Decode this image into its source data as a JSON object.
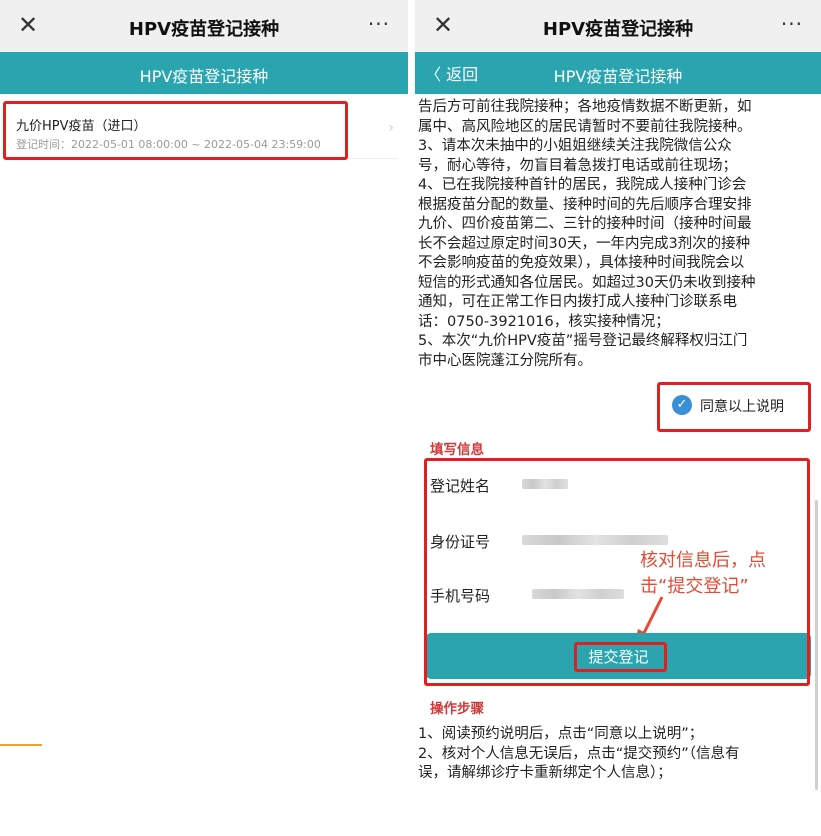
{
  "left_panel": {
    "topbar": {
      "close_icon": "close-icon",
      "title": "HPV疫苗登记接种",
      "more_icon": "more-icon"
    },
    "header": {
      "title": "HPV疫苗登记接种"
    },
    "vaccine_item": {
      "name": "九价HPV疫苗（进口）",
      "time": "登记时间：2022-05-01 08:00:00 ~ 2022-05-04 23:59:00",
      "chevron": "›"
    }
  },
  "right_panel": {
    "topbar": {
      "close_icon": "close-icon",
      "title": "HPV疫苗登记接种",
      "more_icon": "more-icon"
    },
    "header": {
      "back": "〈 返回",
      "title": "HPV疫苗登记接种"
    },
    "notice_lines": [
      "告后方可前往我院接种；各地疫情数据不断更新，如",
      "属中、高风险地区的居民请暂时不要前往我院接种。",
      "3、请本次未抽中的小姐姐继续关注我院微信公众",
      "号，耐心等待，勿盲目着急拨打电话或前往现场；",
      "4、已在我院接种首针的居民，我院成人接种门诊会",
      "根据疫苗分配的数量、接种时间的先后顺序合理安排",
      "九价、四价疫苗第二、三针的接种时间（接种时间最",
      "长不会超过原定时间30天，一年内完成3剂次的接种",
      "不会影响疫苗的免疫效果），具体接种时间我院会以",
      "短信的形式通知各位居民。如超过30天仍未收到接种",
      "通知，可在正常工作日内拨打成人接种门诊联系电",
      "话：0750-3921016，核实接种情况；",
      "5、本次“九价HPV疫苗”摇号登记最终解释权归江门",
      "市中心医院蓬江分院所有。"
    ],
    "agree": {
      "label": "同意以上说明",
      "checked": true
    },
    "fill_section": {
      "title": "填写信息",
      "fields": [
        {
          "label": "登记姓名"
        },
        {
          "label": "身份证号"
        },
        {
          "label": "手机号码"
        }
      ]
    },
    "annotation": {
      "line1": "核对信息后，点",
      "line2": "击“提交登记”"
    },
    "submit_label": "提交登记",
    "steps_section": {
      "title": "操作步骤",
      "lines": [
        "1、阅读预约说明后，点击“同意以上说明”；",
        "2、核对个人信息无误后，点击“提交预约”（信息有",
        "误，请解绑诊疗卡重新绑定个人信息）；"
      ]
    }
  },
  "colors": {
    "accent": "#2aa5b0",
    "highlight": "#e02020",
    "annotation": "#e64a35",
    "check": "#3b8fd6"
  }
}
